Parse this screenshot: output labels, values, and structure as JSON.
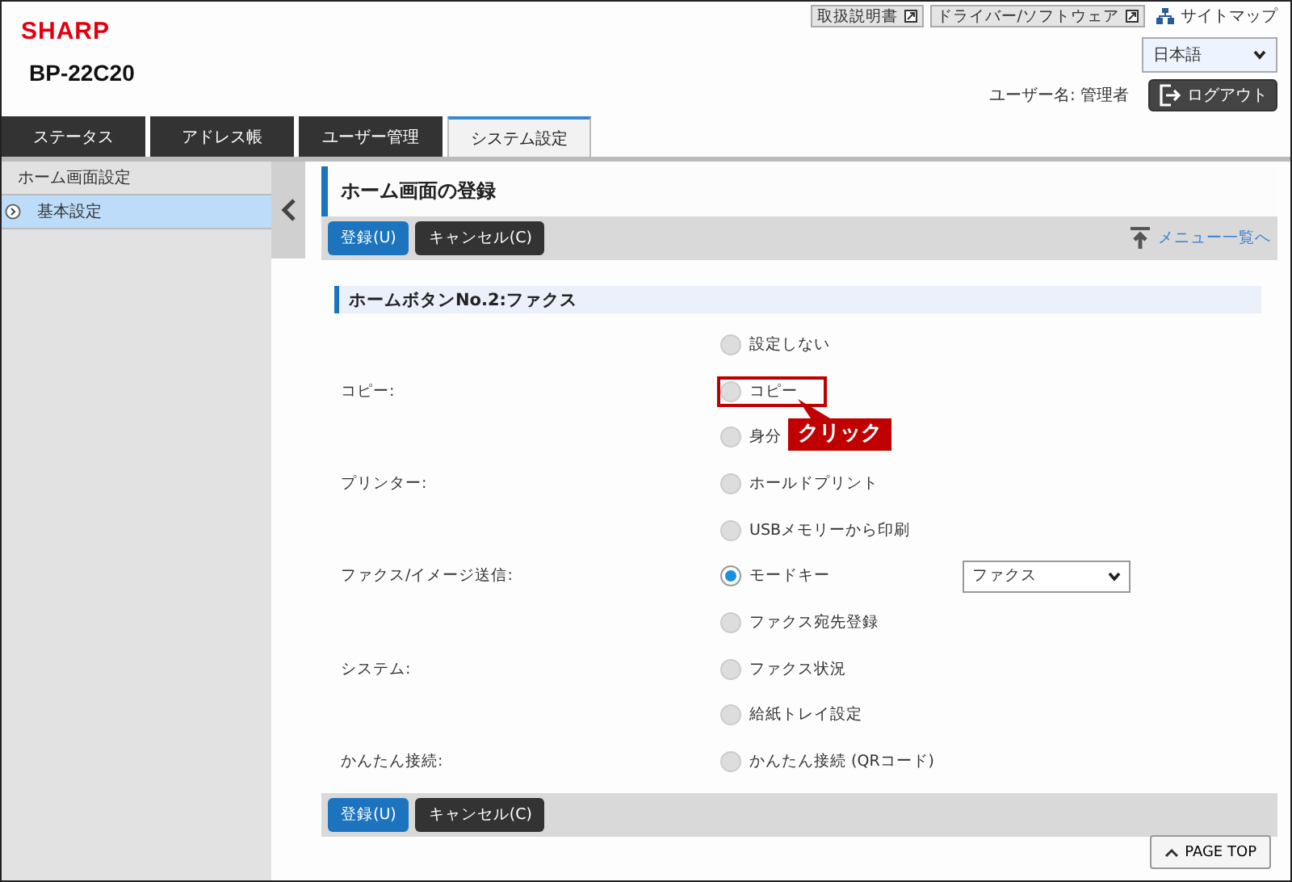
{
  "brand": {
    "logo": "SHARP",
    "model": "BP-22C20"
  },
  "top_links": [
    {
      "label": "取扱説明書"
    },
    {
      "label": "ドライバー/ソフトウェア"
    }
  ],
  "sitemap": "サイトマップ",
  "language": "日本語",
  "user": "ユーザー名: 管理者",
  "logout": "ログアウト",
  "tabs": [
    {
      "label": "ステータス",
      "selected": false
    },
    {
      "label": "アドレス帳",
      "selected": false
    },
    {
      "label": "ユーザー管理",
      "selected": false
    },
    {
      "label": "システム設定",
      "selected": true
    }
  ],
  "sidebar": {
    "items": [
      {
        "label": "ホーム画面設定",
        "selected": false,
        "kind": "heading"
      },
      {
        "label": "基本設定",
        "selected": true,
        "kind": "link"
      }
    ]
  },
  "page_title": "ホーム画面の登録",
  "actions": [
    {
      "label": "登録(U)",
      "kind": "primary"
    },
    {
      "label": "キャンセル(C)",
      "kind": "secondary"
    }
  ],
  "menu_link": "メニュー一覧へ",
  "section_title": "ホームボタンNo.2:ファクス",
  "rows": [
    {
      "option": "設定しない",
      "selected": false
    },
    {
      "label": "コピー:",
      "option": "コピー",
      "selected": false,
      "highlighted": true
    },
    {
      "option": "身分",
      "selected": false
    },
    {
      "label": "プリンター:",
      "option": "ホールドプリント",
      "selected": false
    },
    {
      "option": "USBメモリーから印刷",
      "selected": false
    },
    {
      "label": "ファクス/イメージ送信:",
      "option": "モードキー",
      "selected": true,
      "select": "ファクス"
    },
    {
      "option": "ファクス宛先登録",
      "selected": false
    },
    {
      "label": "システム:",
      "option": "ファクス状況",
      "selected": false
    },
    {
      "option": "給紙トレイ設定",
      "selected": false
    },
    {
      "label": "かんたん接続:",
      "option": "かんたん接続 (QRコード)",
      "selected": false
    }
  ],
  "callout": "クリック",
  "bottom_actions": [
    {
      "label": "登録(U)",
      "kind": "primary"
    },
    {
      "label": "キャンセル(C)",
      "kind": "secondary"
    }
  ],
  "page_top": "PAGE TOP"
}
